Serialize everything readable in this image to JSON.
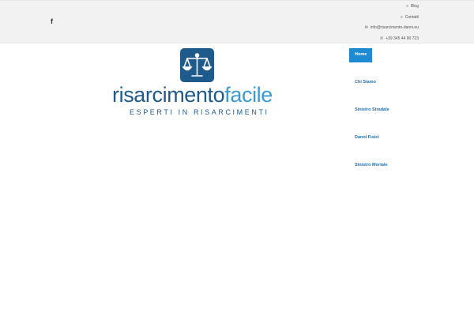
{
  "topbar": {
    "social_icon": "facebook-icon",
    "social_glyph": "f",
    "links": [
      {
        "icon": "chevron-right-icon",
        "glyph": "»",
        "label": "Blog"
      },
      {
        "icon": "chevron-right-icon",
        "glyph": "»",
        "label": "Contatti"
      },
      {
        "icon": "envelope-icon",
        "glyph": "✉",
        "label": "info@risarcimento-danni.eu"
      },
      {
        "icon": "phone-icon",
        "glyph": "✆",
        "label": "+39 345 44 90 723"
      }
    ]
  },
  "logo": {
    "word_part1": "risarcimento",
    "word_part2": "facile",
    "tagline": "ESPERTI IN RISARCIMENTI",
    "mark_icon": "scales-of-justice-icon",
    "colors": {
      "primary": "#1e5a8c",
      "secondary": "#3a9ad4"
    }
  },
  "nav": {
    "items": [
      {
        "label": "Home",
        "active": true
      },
      {
        "label": "Chi Siamo",
        "active": false
      },
      {
        "label": "Sinistro Stradale",
        "active": false
      },
      {
        "label": "Danni Fisici",
        "active": false
      },
      {
        "label": "Sinistro Mortale",
        "active": false
      }
    ],
    "active_color": "#1e8ad3",
    "link_color": "#1e6fb0"
  }
}
